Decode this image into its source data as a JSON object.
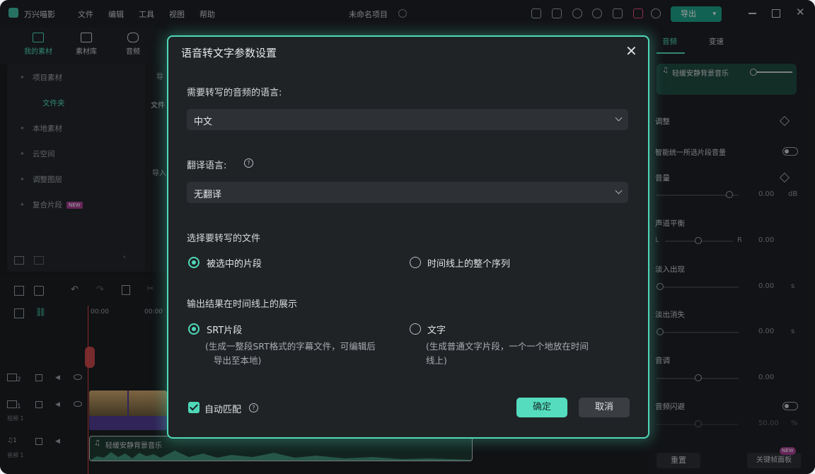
{
  "app": {
    "name": "万兴喵影",
    "project_title": "未命名项目",
    "menu": [
      "文件",
      "编辑",
      "工具",
      "视图",
      "帮助"
    ],
    "export_label": "导出"
  },
  "left_tabs": [
    {
      "label": "我的素材",
      "active": true
    },
    {
      "label": "素材库",
      "active": false
    },
    {
      "label": "音频",
      "active": false
    }
  ],
  "tree": {
    "items": [
      "项目素材",
      "文件夹",
      "本地素材",
      "云空间",
      "调整图层",
      "复合片段"
    ],
    "new_badge": "NEW"
  },
  "media_partial": {
    "import": "导",
    "folder": "文件",
    "import2": "导入"
  },
  "timeline": {
    "ruler_labels": [
      "00:00",
      "00:00"
    ],
    "track_video_label": "视频 1",
    "track_audio_label": "音频 1",
    "track_numbers": [
      "2",
      "1",
      "1"
    ],
    "audio_clip_name": "轻缓安静背景音乐"
  },
  "right_panel": {
    "tabs": [
      "音频",
      "变速"
    ],
    "audio_clip_name": "轻缓安静背景音乐",
    "section_adjust": "调整",
    "smart_normalize": "智能统一所选片段音量",
    "volume_label": "音量",
    "volume_value": "0.00",
    "volume_unit": "dB",
    "balance_label": "声道平衡",
    "balance_l": "L",
    "balance_r": "R",
    "balance_value": "0.00",
    "fade_in_label": "淡入出现",
    "fade_in_value": "0.00",
    "fade_in_unit": "s",
    "fade_out_label": "淡出消失",
    "fade_out_value": "0.00",
    "fade_out_unit": "s",
    "pitch_label": "音调",
    "pitch_value": "0.00",
    "ducking_label": "音频闪避",
    "ducking_value": "50.00",
    "ducking_unit": "%",
    "reset_label": "重置",
    "keyframe_panel_label": "关键帧面板",
    "new_badge": "NEW"
  },
  "dialog": {
    "title": "语音转文字参数设置",
    "audio_language_label": "需要转写的音频的语言:",
    "audio_language_value": "中文",
    "translate_label": "翻译语言:",
    "translate_value": "无翻译",
    "select_file_label": "选择要转写的文件",
    "option_selected_clip": "被选中的片段",
    "option_whole_sequence": "时间线上的整个序列",
    "output_label": "输出结果在时间线上的展示",
    "option_srt": "SRT片段",
    "option_srt_desc_1": "(生成一整段SRT格式的字幕文件，可编辑后",
    "option_srt_desc_2": "导出至本地)",
    "option_text": "文字",
    "option_text_desc_1": "(生成普通文字片段，一个一个地放在时间",
    "option_text_desc_2": "线上)",
    "auto_match_label": "自动匹配",
    "ok_label": "确定",
    "cancel_label": "取消"
  },
  "colors": {
    "accent": "#4fd8b8",
    "export_button": "#1e9e86",
    "dialog_bg": "#202326"
  }
}
